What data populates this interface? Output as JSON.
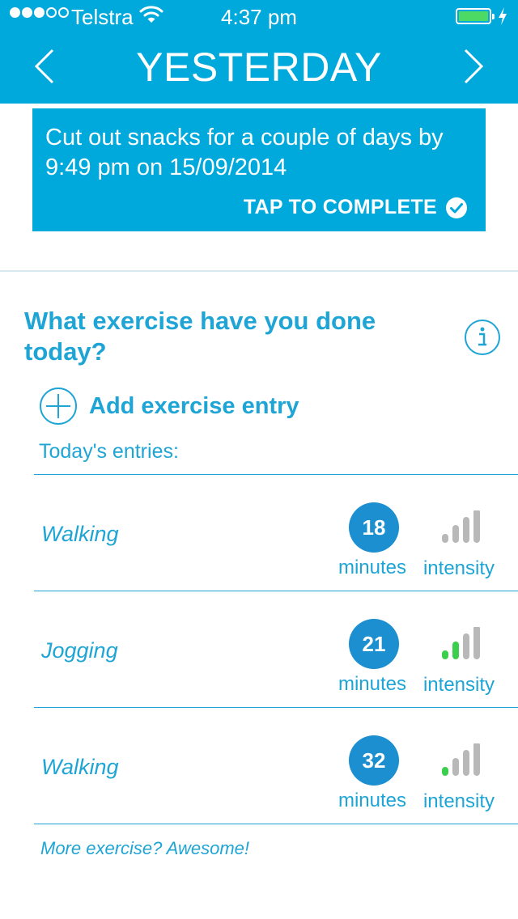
{
  "status_bar": {
    "carrier": "Telstra",
    "time": "4:37 pm",
    "signal_bars_filled": 3,
    "signal_bars_total": 5,
    "battery_color": "#4cd964",
    "icons": [
      "signal-dots-icon",
      "wifi-icon",
      "battery-icon",
      "charging-bolt-icon"
    ]
  },
  "header": {
    "title": "YESTERDAY",
    "background": "#00a9dc",
    "prev_icon": "chevron-left-icon",
    "next_icon": "chevron-right-icon"
  },
  "goal": {
    "text": "Cut out snacks for a couple of days by 9:49 pm on 15/09/2014",
    "action_label": "TAP TO COMPLETE",
    "action_icon": "check-circle-icon"
  },
  "exercise": {
    "question": "What exercise have you done today?",
    "info_icon": "info-icon",
    "add_label": "Add exercise entry",
    "add_icon": "plus-circle-icon",
    "entries_label": "Today's entries:",
    "entries": [
      {
        "activity": "Walking",
        "minutes": "18",
        "minutes_label": "minutes",
        "intensity_label": "intensity",
        "intensity_level": 0
      },
      {
        "activity": "Jogging",
        "minutes": "21",
        "minutes_label": "minutes",
        "intensity_label": "intensity",
        "intensity_level": 2
      },
      {
        "activity": "Walking",
        "minutes": "32",
        "minutes_label": "minutes",
        "intensity_label": "intensity",
        "intensity_level": 1
      }
    ],
    "intensity_levels_total": 4,
    "intensity_active_color": "#3ccf4e",
    "intensity_inactive_color": "#b8b8b8",
    "footer": "More exercise? Awesome!"
  }
}
